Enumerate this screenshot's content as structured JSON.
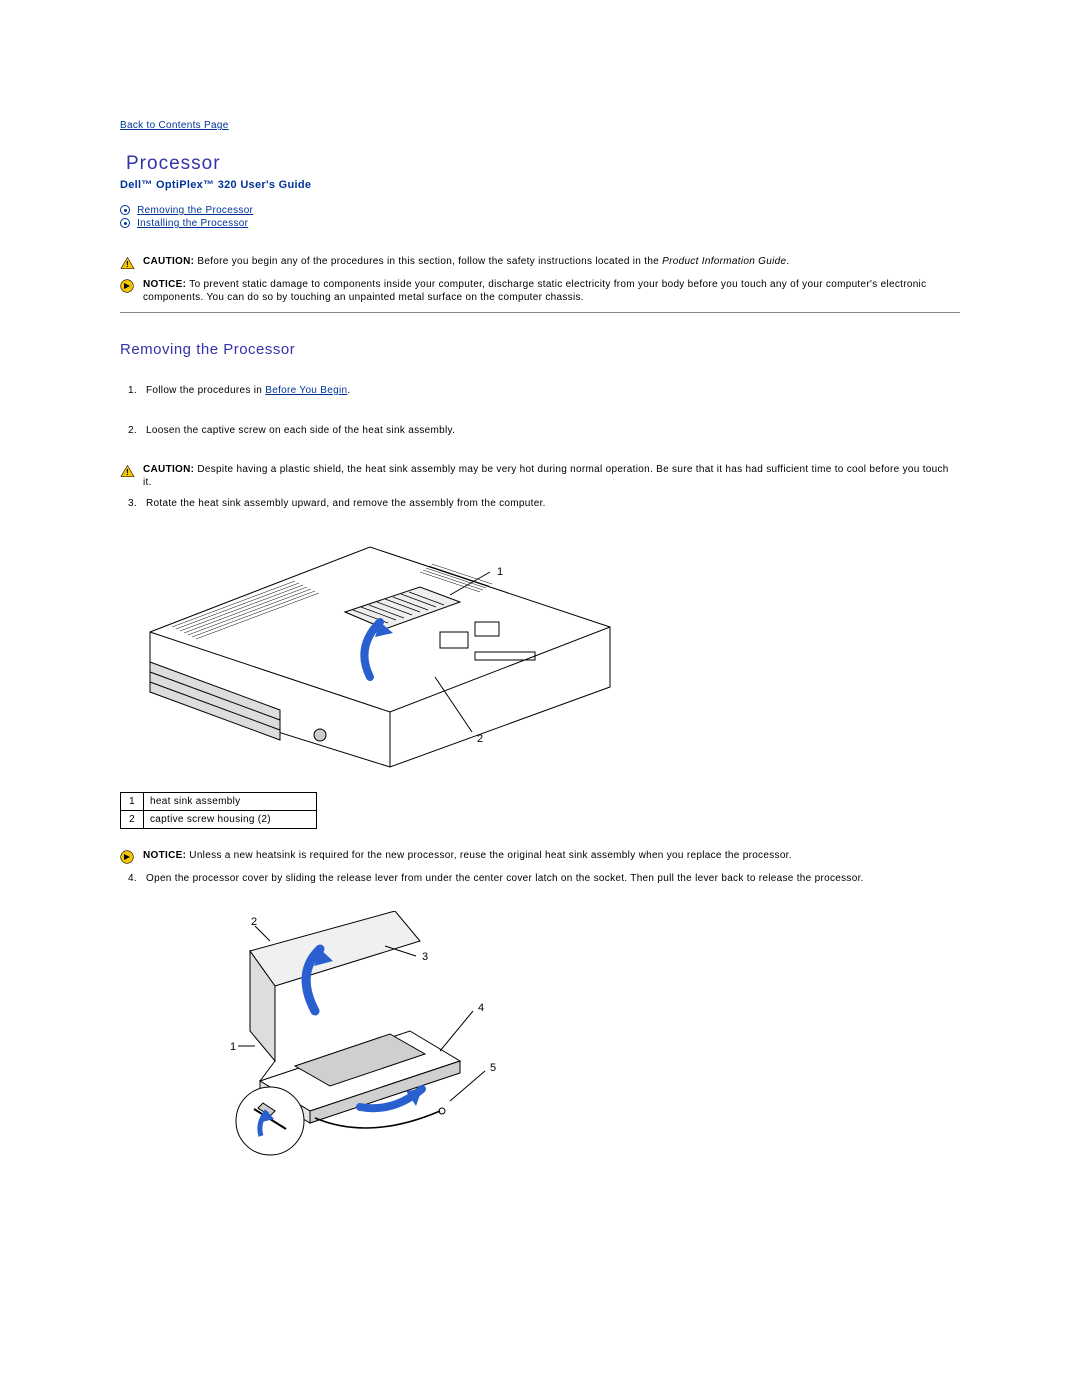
{
  "nav": {
    "back": "Back to Contents Page"
  },
  "title": "Processor",
  "subtitle": "Dell™ OptiPlex™ 320 User's Guide",
  "toc": {
    "item1": "Removing the Processor",
    "item2": "Installing the Processor"
  },
  "alerts": {
    "caution1_label": "CAUTION: ",
    "caution1_text": "Before you begin any of the procedures in this section, follow the safety instructions located in the ",
    "caution1_italic": "Product Information Guide",
    "notice1_label": "NOTICE: ",
    "notice1_text": "To prevent static damage to components inside your computer, discharge static electricity from your body before you touch any of your computer's electronic components. You can do so by touching an unpainted metal surface on the computer chassis.",
    "caution2_label": "CAUTION: ",
    "caution2_text": "Despite having a plastic shield, the heat sink assembly may be very hot during normal operation. Be sure that it has had sufficient time to cool before you touch it.",
    "notice2_label": "NOTICE: ",
    "notice2_text": "Unless a new heatsink is required for the new processor, reuse the original heat sink assembly when you replace the processor."
  },
  "section1": {
    "title": "Removing the Processor"
  },
  "steps": {
    "s1_pre": "Follow the procedures in ",
    "s1_link": "Before You Begin",
    "s1_post": ".",
    "s2": "Loosen the captive screw on each side of the heat sink assembly.",
    "s3": "Rotate the heat sink assembly upward, and remove the assembly from the computer.",
    "s4": "Open the processor cover by sliding the release lever from under the center cover latch on the socket. Then pull the lever back to release the processor."
  },
  "parts": {
    "r1n": "1",
    "r1t": "heat sink assembly",
    "r2n": "2",
    "r2t": "captive screw housing (2)"
  },
  "fig1": {
    "l1": "1",
    "l2": "2"
  },
  "fig2": {
    "l1": "1",
    "l2": "2",
    "l3": "3",
    "l4": "4",
    "l5": "5"
  }
}
